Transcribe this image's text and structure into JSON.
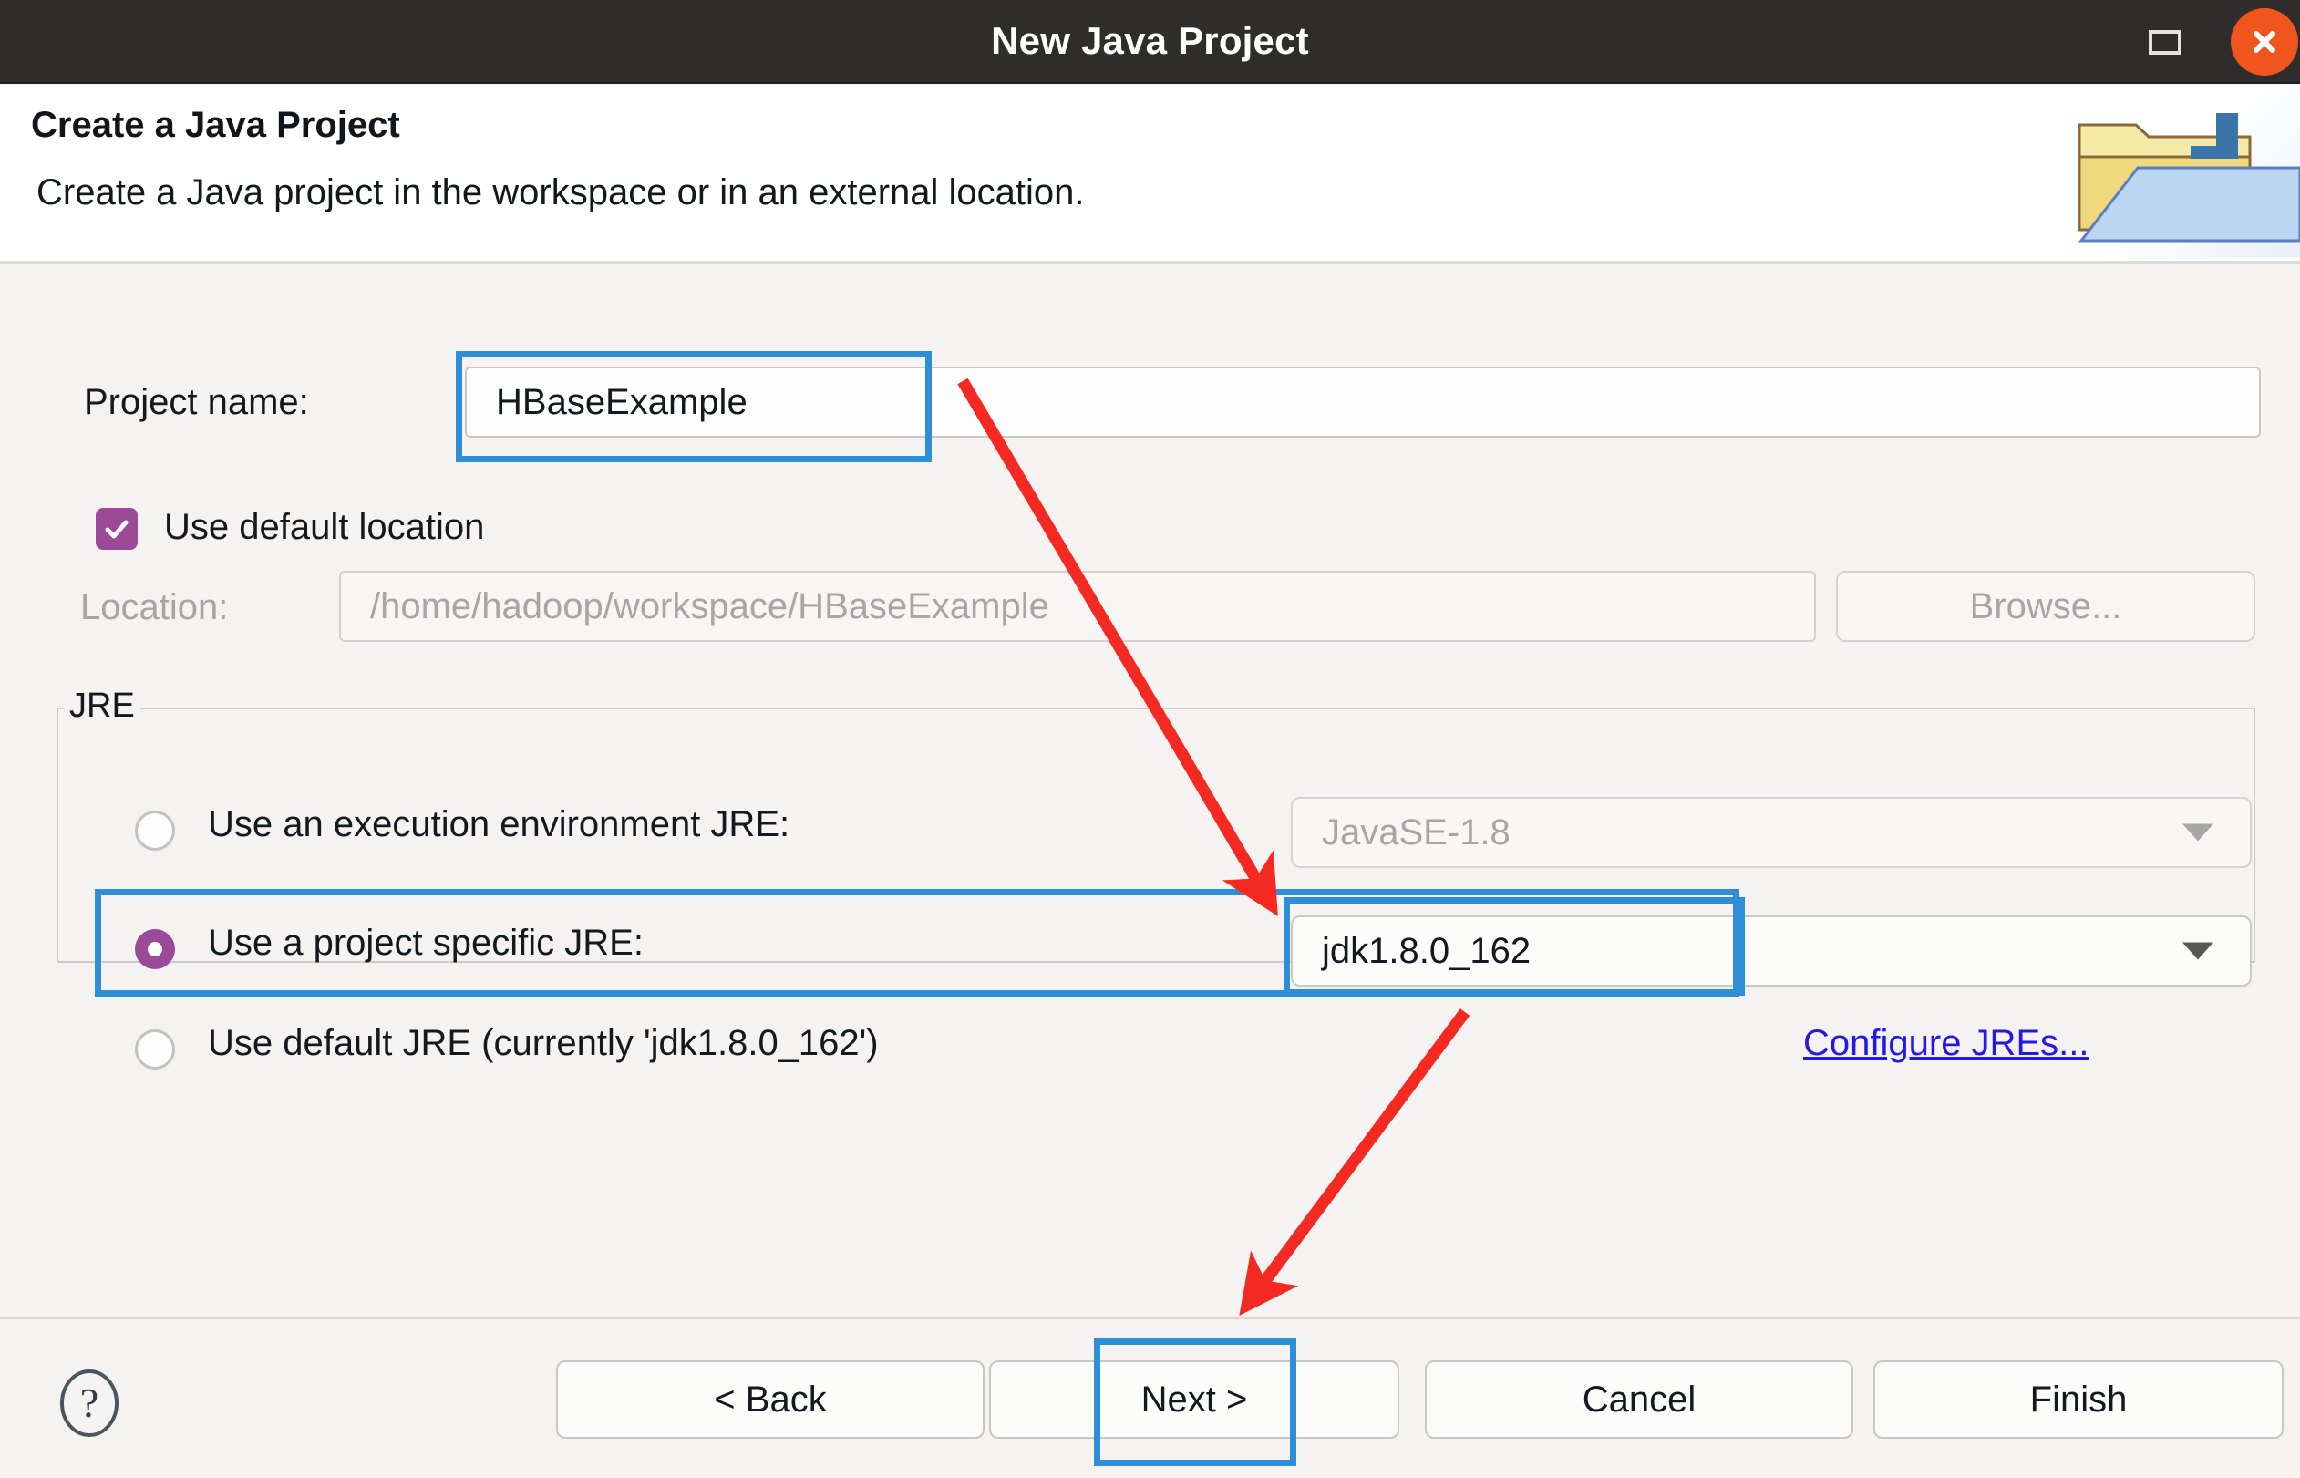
{
  "window": {
    "title": "New Java Project",
    "maximize_icon": "maximize-icon",
    "close_icon": "close-icon"
  },
  "header": {
    "title": "Create a Java Project",
    "description": "Create a Java project in the workspace or in an external location.",
    "icon": "java-project-folder-icon"
  },
  "form": {
    "project_name_label": "Project name:",
    "project_name_value": "HBaseExample",
    "use_default_location_label": "Use default location",
    "use_default_location_checked": true,
    "location_label": "Location:",
    "location_value": "/home/hadoop/workspace/HBaseExample",
    "browse_label": "Browse...",
    "browse_enabled": false
  },
  "jre": {
    "group_label": "JRE",
    "options": [
      {
        "label": "Use an execution environment JRE:",
        "selected": false,
        "combo_value": "JavaSE-1.8",
        "combo_enabled": false
      },
      {
        "label": "Use a project specific JRE:",
        "selected": true,
        "combo_value": "jdk1.8.0_162",
        "combo_enabled": true
      },
      {
        "label": "Use default JRE (currently 'jdk1.8.0_162')",
        "selected": false
      }
    ],
    "configure_link": "Configure JREs..."
  },
  "footer": {
    "help_icon": "help-icon",
    "buttons": [
      {
        "label": "< Back",
        "enabled": true
      },
      {
        "label": "Next >",
        "enabled": true
      },
      {
        "label": "Cancel",
        "enabled": true
      },
      {
        "label": "Finish",
        "enabled": true
      }
    ]
  },
  "annotations": {
    "highlight_color": "#2e8fd8",
    "arrow_color": "#f42a22",
    "highlighted": [
      "project-name-input",
      "project-specific-jre-row",
      "jdk-combo-value",
      "next-button"
    ],
    "arrows": 2
  }
}
